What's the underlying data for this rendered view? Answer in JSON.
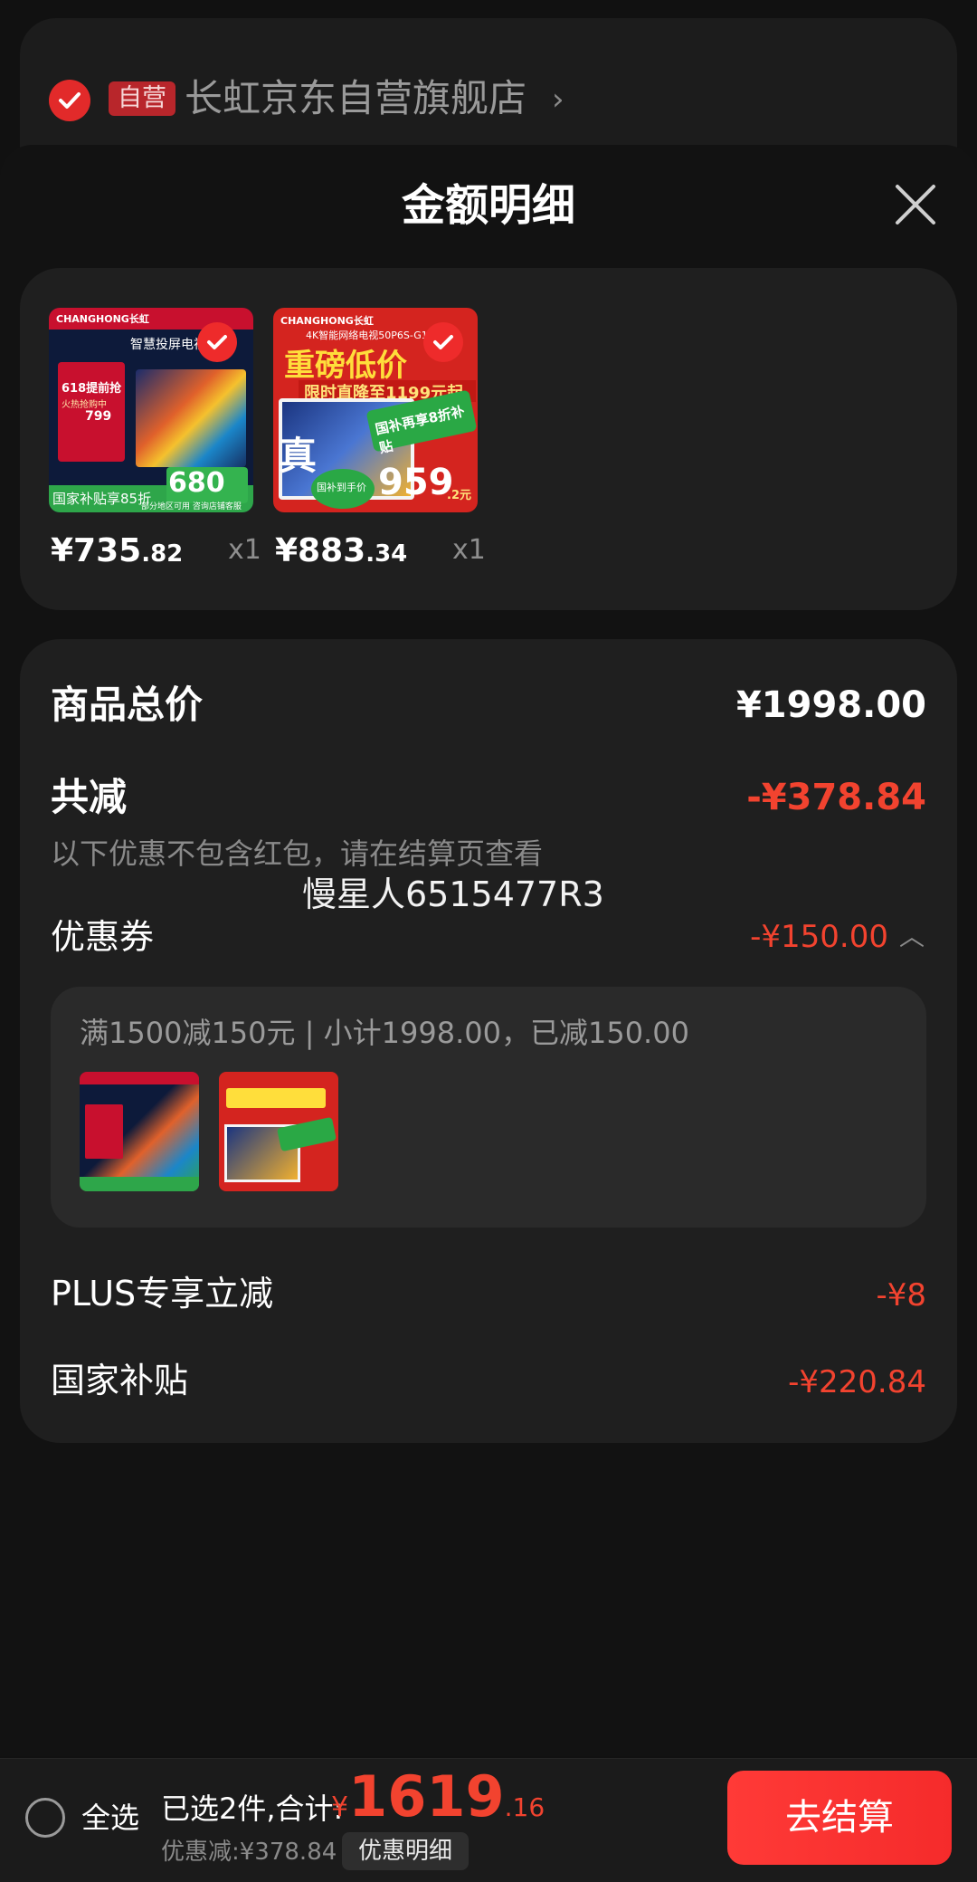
{
  "store": {
    "badge": "自营",
    "name": "长虹京东自营旗舰店",
    "chevron": "›"
  },
  "sheet": {
    "title": "金额明细",
    "close_icon": "close-icon"
  },
  "products": [
    {
      "price_int": "¥735",
      "price_dec": ".82",
      "qty": "x1",
      "img_brand": "CHANGHONG长虹",
      "img_tagline": "智慧投屏电视",
      "img_promo": "618提前抢",
      "img_sub": "火热抢购中",
      "img_price": "799",
      "img_big": "680",
      "img_bottom": "国家补贴享85折",
      "img_foot": "部分地区可用 咨询店铺客服"
    },
    {
      "price_int": "¥883",
      "price_dec": ".34",
      "qty": "x1",
      "img_brand": "CHANGHONG长虹",
      "img_tagline": "4K智能网络电视50P6S-G1",
      "img_promo": "重磅低价",
      "img_sub": "限时直降至1199元起",
      "img_badge": "国补再享8折补贴",
      "img_big": "959",
      "img_big_dec": ".2元",
      "img_corner": "真",
      "img_foot": "国补到手价"
    }
  ],
  "summary": {
    "total_label": "商品总价",
    "total_value": "¥1998.00",
    "reduce_label": "共减",
    "reduce_value": "-¥378.84",
    "note": "以下优惠不包含红包，请在结算页查看",
    "overlay_text": "慢星人6515477R3",
    "coupon_label": "优惠券",
    "coupon_value": "-¥150.00",
    "coupon_chevron": "︿",
    "coupon_detail": "满1500减150元 | 小计1998.00，已减150.00",
    "plus_label": "PLUS专享立减",
    "plus_value": "-¥8",
    "subsidy_label": "国家补贴",
    "subsidy_value": "-¥220.84"
  },
  "bottom": {
    "select_all": "全选",
    "selected_text": "已选2件,合计:",
    "total_symbol": "¥",
    "total_int": "1619",
    "total_dec": ".16",
    "discount_text": "优惠减:¥378.84",
    "detail_button": "优惠明细",
    "checkout_button": "去结算"
  },
  "colors": {
    "accent_red": "#f2432f",
    "checkout_red": "#ff3a37",
    "panel": "#1f1f1f",
    "background": "#111111"
  }
}
